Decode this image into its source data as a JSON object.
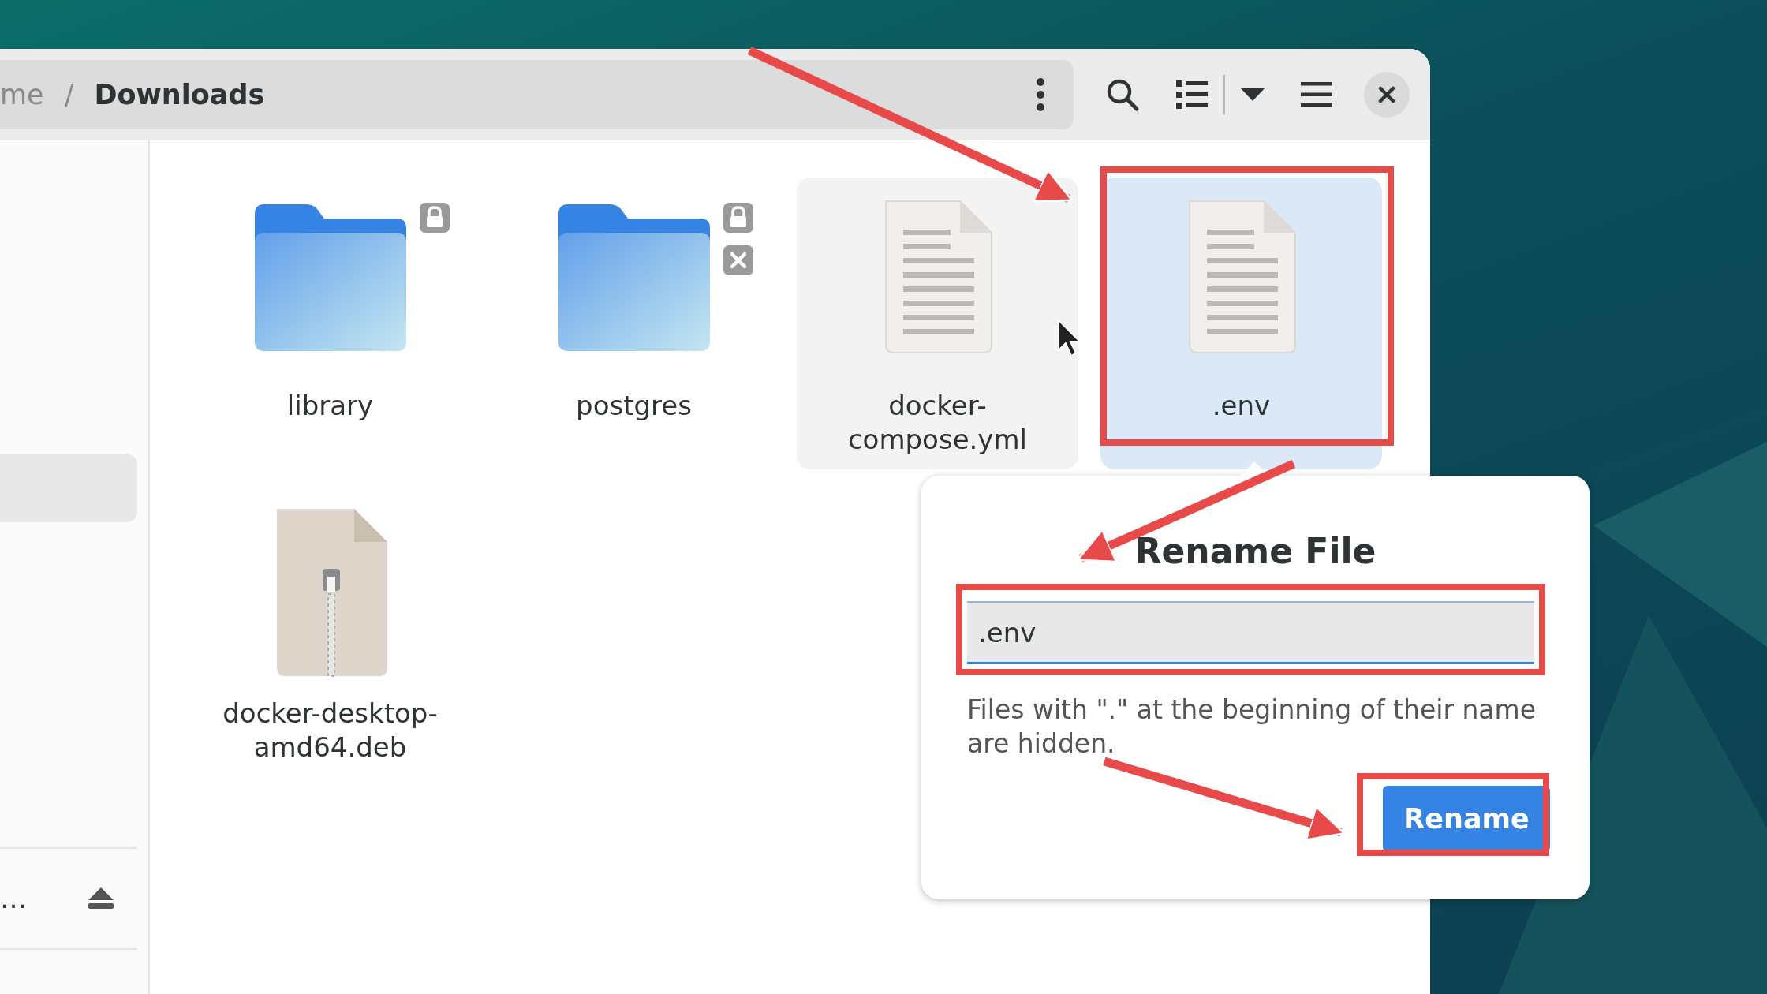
{
  "header": {
    "breadcrumb": [
      {
        "label": "me",
        "current": false
      },
      {
        "label": "Downloads",
        "current": true
      }
    ],
    "separator": "/"
  },
  "sidebar": {
    "items": [
      {
        "selected": true
      }
    ],
    "mount": {
      "label": "…"
    }
  },
  "files": [
    {
      "name": "library",
      "kind": "folder",
      "emblems": [
        {
          "kind": "lock"
        }
      ],
      "selected": false,
      "hovered": false
    },
    {
      "name": "postgres",
      "kind": "folder",
      "emblems": [
        {
          "kind": "lock"
        },
        {
          "kind": "unwritable"
        }
      ],
      "selected": false,
      "hovered": false
    },
    {
      "name": "docker-compose.yml",
      "kind": "text",
      "selected": false,
      "hovered": true
    },
    {
      "name": ".env",
      "kind": "text",
      "selected": true,
      "hovered": false
    },
    {
      "name": "docker-desktop-amd64.deb",
      "kind": "archive",
      "selected": false,
      "hovered": false
    }
  ],
  "rename_popover": {
    "title": "Rename File",
    "value": ".env",
    "hint": "Files with \".\" at the beginning of their name are hidden.",
    "button": "Rename"
  }
}
